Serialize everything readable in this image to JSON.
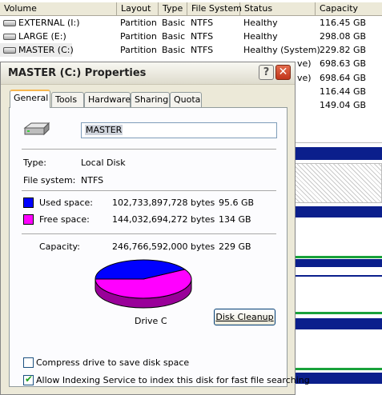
{
  "grid": {
    "headers": [
      "Volume",
      "Layout",
      "Type",
      "File System",
      "Status",
      "Capacity"
    ],
    "rows": [
      {
        "volume": "EXTERNAL (I:)",
        "layout": "Partition",
        "type": "Basic",
        "fs": "NTFS",
        "status": "Healthy",
        "capacity": "116.45 GB"
      },
      {
        "volume": "LARGE (E:)",
        "layout": "Partition",
        "type": "Basic",
        "fs": "NTFS",
        "status": "Healthy",
        "capacity": "298.08 GB"
      },
      {
        "volume": "MASTER (C:)",
        "layout": "Partition",
        "type": "Basic",
        "fs": "NTFS",
        "status": "Healthy (System)",
        "capacity": "229.82 GB"
      }
    ],
    "partial_rows": [
      {
        "status": "ve)",
        "capacity": "698.63 GB"
      },
      {
        "status": "ve)",
        "capacity": "698.64 GB"
      },
      {
        "status": "",
        "capacity": "116.44 GB"
      },
      {
        "status": "",
        "capacity": "149.04 GB"
      }
    ]
  },
  "dialog": {
    "title": "MASTER (C:) Properties",
    "help_glyph": "?",
    "close_glyph": "✕",
    "tabs": [
      "General",
      "Tools",
      "Hardware",
      "Sharing",
      "Quota"
    ],
    "active_tab": "General",
    "volume_name": "MASTER",
    "type_label": "Type:",
    "type_value": "Local Disk",
    "fs_label": "File system:",
    "fs_value": "NTFS",
    "used_label": "Used space:",
    "used_bytes": "102,733,897,728 bytes",
    "used_gb": "95.6 GB",
    "free_label": "Free space:",
    "free_bytes": "144,032,694,272 bytes",
    "free_gb": "134 GB",
    "capacity_label": "Capacity:",
    "capacity_bytes": "246,766,592,000 bytes",
    "capacity_gb": "229 GB",
    "drive_label": "Drive C",
    "cleanup_button": "Disk Cleanup",
    "compress_label": "Compress drive to save disk space",
    "compress_checked": false,
    "index_label": "Allow Indexing Service to index this disk for fast file searching",
    "index_checked": true,
    "used_fraction": 0.416,
    "colors": {
      "used": "#0000ff",
      "free": "#ff00ff"
    }
  }
}
